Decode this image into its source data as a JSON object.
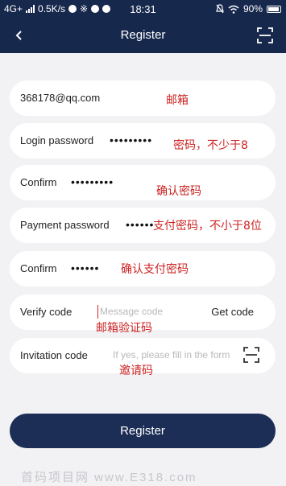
{
  "status_bar": {
    "network": "4G+",
    "speed": "0.5K/s",
    "extra": "※",
    "time": "18:31",
    "battery": "90%"
  },
  "nav": {
    "back_icon": "chevron-left-icon",
    "title": "Register",
    "scan_icon": "scan-icon"
  },
  "form": {
    "email": {
      "value": "368178@qq.com",
      "note": "邮箱"
    },
    "login_password": {
      "label": "Login password",
      "masked": "•••••••••",
      "note": "密码，不少于8"
    },
    "confirm_login": {
      "label": "Confirm",
      "masked": "•••••••••",
      "note": "确认密码"
    },
    "payment_password": {
      "label": "Payment password",
      "masked": "••••••",
      "note": "支付密码，不小于8位"
    },
    "confirm_payment": {
      "label": "Confirm",
      "masked": "••••••",
      "note": "确认支付密码"
    },
    "verify_code": {
      "label": "Verify code",
      "placeholder": "Message code",
      "button": "Get code",
      "note": "邮箱验证码"
    },
    "invitation": {
      "label": "Invitation code",
      "placeholder": "If yes, please fill in the form",
      "note": "邀请码"
    }
  },
  "submit": {
    "label": "Register"
  },
  "watermark": "首码项目网 www.E318.com",
  "colors": {
    "header": "#17284d",
    "button": "#1c2e56",
    "background": "#f2f2f4",
    "annotation": "#cc2222"
  }
}
